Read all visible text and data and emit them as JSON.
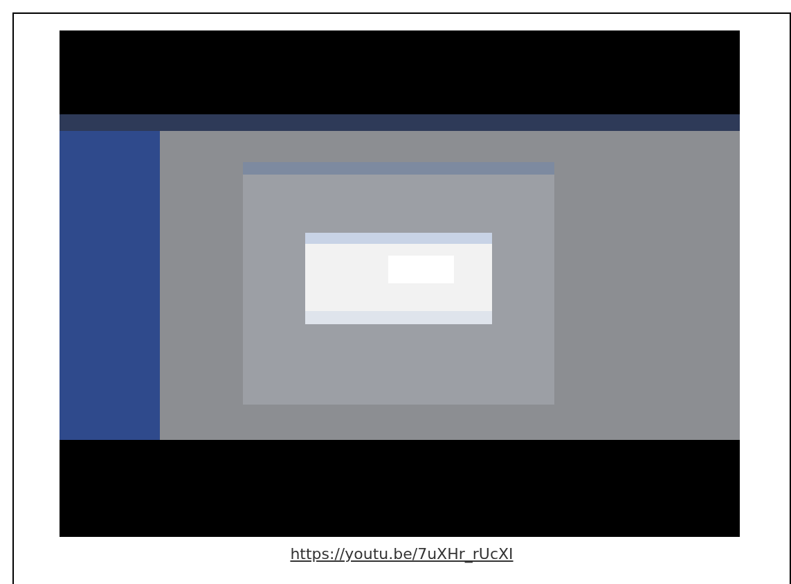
{
  "link": {
    "text": "https://youtu.be/7uXHr_rUcXI"
  }
}
